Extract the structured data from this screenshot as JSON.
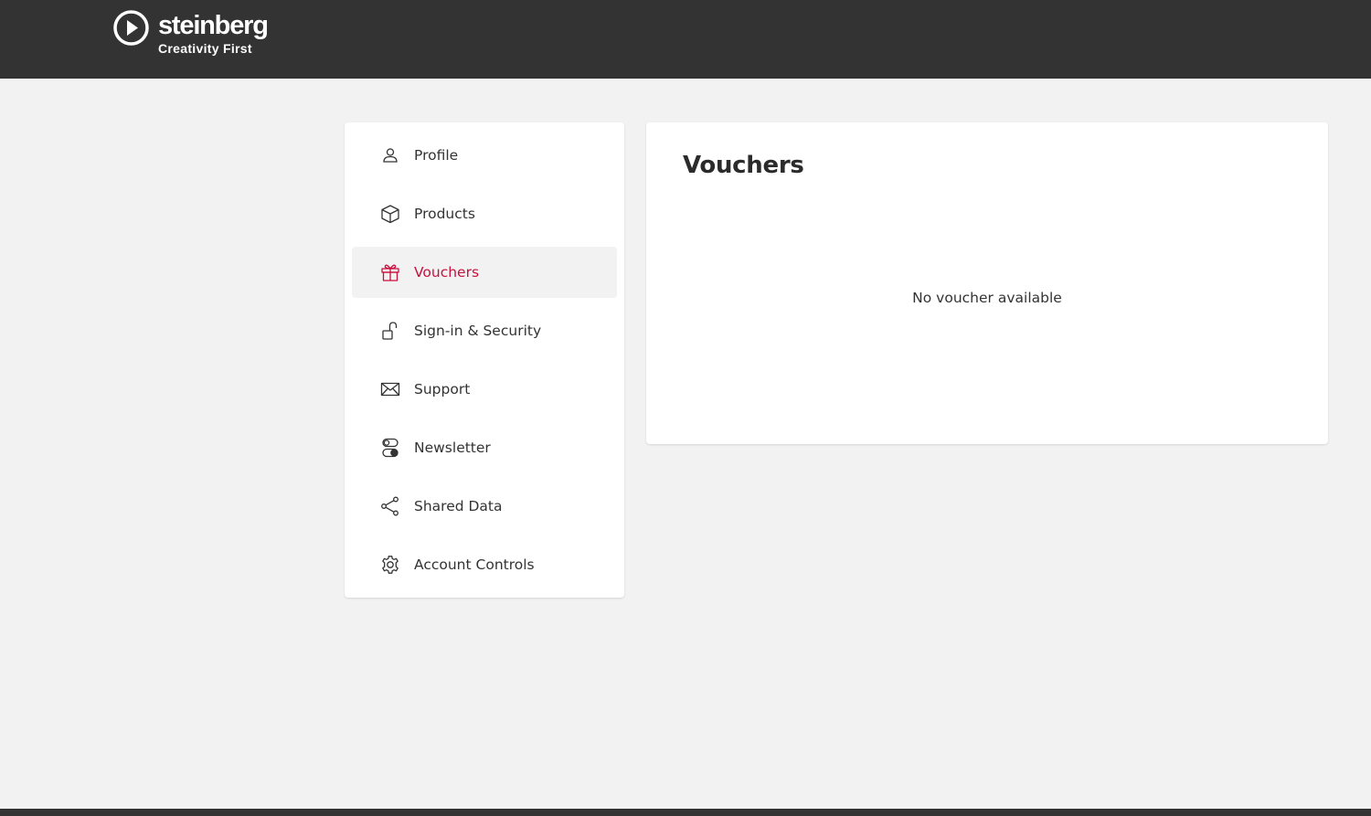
{
  "header": {
    "brand_name": "steinberg",
    "brand_tagline": "Creativity First",
    "background_color": "#333333"
  },
  "sidebar": {
    "active_color": "#c8103e",
    "items": [
      {
        "label": "Profile",
        "icon": "person-icon",
        "active": false
      },
      {
        "label": "Products",
        "icon": "box-icon",
        "active": false
      },
      {
        "label": "Vouchers",
        "icon": "gift-icon",
        "active": true
      },
      {
        "label": "Sign-in & Security",
        "icon": "unlock-icon",
        "active": false
      },
      {
        "label": "Support",
        "icon": "envelope-icon",
        "active": false
      },
      {
        "label": "Newsletter",
        "icon": "toggles-icon",
        "active": false
      },
      {
        "label": "Shared Data",
        "icon": "share-icon",
        "active": false
      },
      {
        "label": "Account Controls",
        "icon": "gear-icon",
        "active": false
      }
    ]
  },
  "main": {
    "title": "Vouchers",
    "empty_message": "No voucher available"
  }
}
